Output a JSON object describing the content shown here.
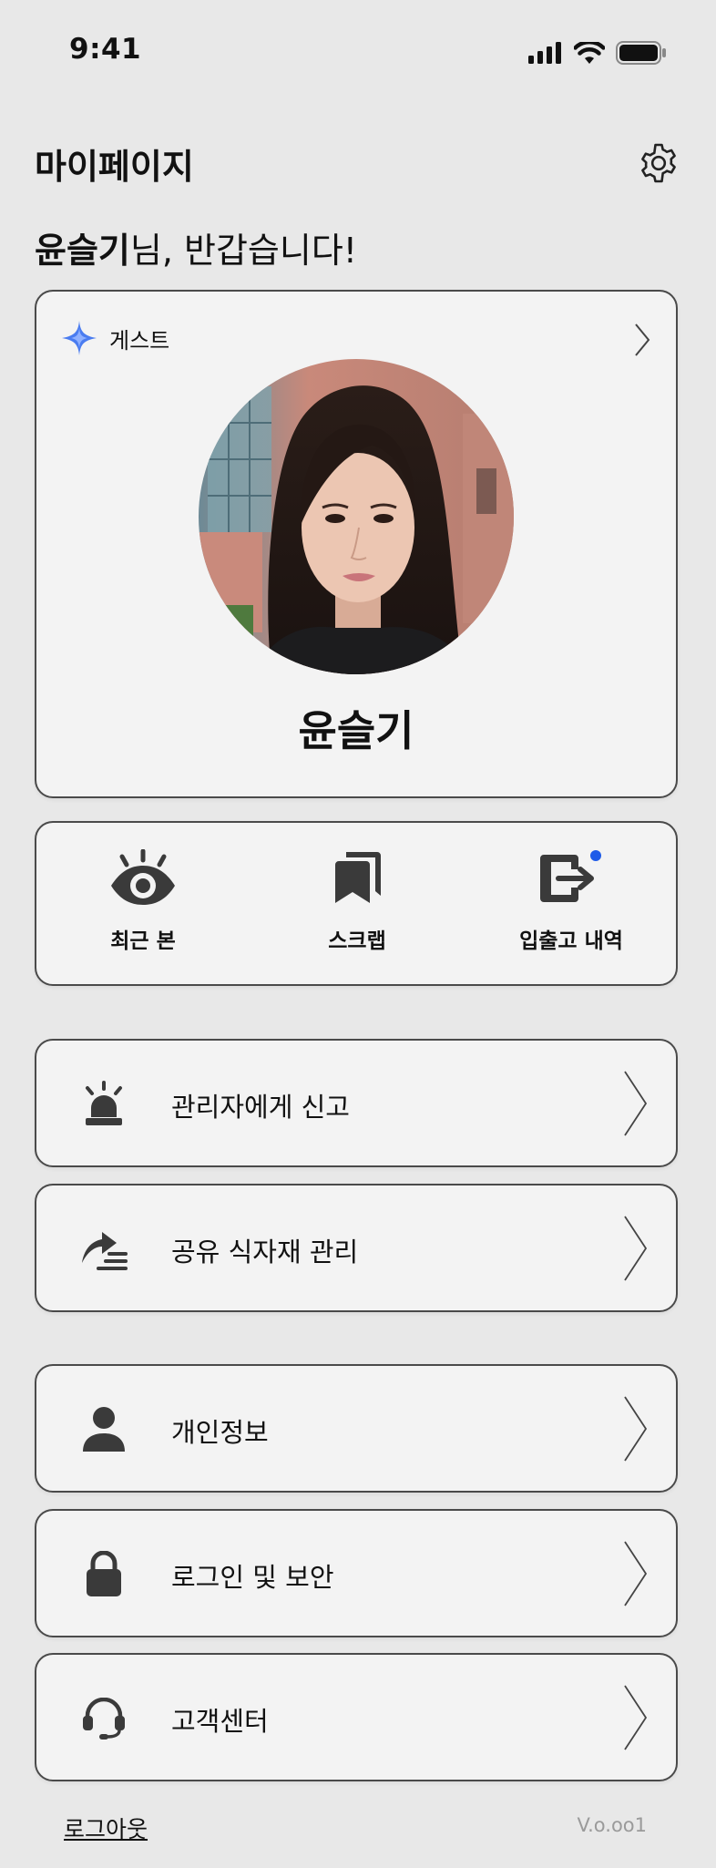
{
  "status_bar": {
    "time": "9:41",
    "icons": [
      "signal-icon",
      "wifi-icon",
      "battery-icon"
    ]
  },
  "header": {
    "title": "마이페이지",
    "settings_icon": "gear-icon"
  },
  "greeting": {
    "name": "윤슬기",
    "suffix": "님, 반갑습니다!"
  },
  "profile": {
    "role": "게스트",
    "role_icon": "sparkle-icon",
    "role_icon_color": "#4a7cf0",
    "name": "윤슬기"
  },
  "quick_actions": [
    {
      "label": "최근 본",
      "icon": "eye-icon"
    },
    {
      "label": "스크랩",
      "icon": "bookmark-stack-icon"
    },
    {
      "label": "입출고 내역",
      "icon": "exit-arrow-icon",
      "has_notification": true
    }
  ],
  "notification_color": "#1e5be8",
  "menu_group_1": [
    {
      "label": "관리자에게 신고",
      "icon": "alarm-siren-icon"
    },
    {
      "label": "공유 식자재 관리",
      "icon": "share-list-icon"
    }
  ],
  "menu_group_2": [
    {
      "label": "개인정보",
      "icon": "person-icon"
    },
    {
      "label": "로그인 및 보안",
      "icon": "lock-icon"
    },
    {
      "label": "고객센터",
      "icon": "headset-icon"
    }
  ],
  "footer": {
    "logout": "로그아웃",
    "version": "V.o.oo1"
  },
  "colors": {
    "background": "#e8e8e8",
    "card": "#f3f3f3",
    "border": "#4a4a4a",
    "icon": "#3a3a3a"
  }
}
